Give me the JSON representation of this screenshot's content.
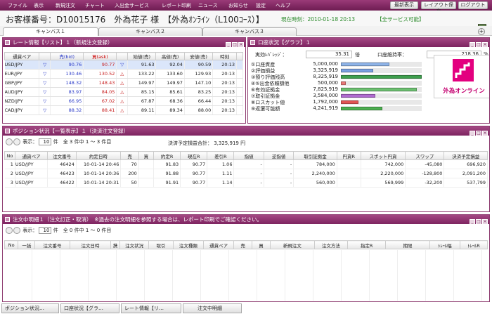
{
  "menu": {
    "items": [
      "ファイル",
      "表示",
      "新規注文",
      "チャート",
      "入出金サービス",
      "レポート印刷",
      "ニュース",
      "お知らせ",
      "設定",
      "ヘルプ"
    ]
  },
  "top_buttons": {
    "latest": "最新表示",
    "save_layout": "レイアウト保存",
    "logout": "ログアウト"
  },
  "customer": {
    "label": "お客様番号：D10015176　外為花子 様　【外為ｵﾝﾗｲﾝ（L100ｺｰｽ）】"
  },
  "clock": {
    "text": "現在時刻：2010-01-18 20:13"
  },
  "service": {
    "text": "【全サービス可能】"
  },
  "canvas_tabs": [
    "キャンバス１",
    "キャンバス２",
    "キャンバス３"
  ],
  "rate_panel": {
    "title": "レート情報【リスト】１（新規注文登録）",
    "headers": [
      "通貨ペア",
      "売(bid)",
      "買(ask)",
      "始値(売)",
      "高値(売)",
      "安値(売)",
      "時刻"
    ],
    "rows": [
      {
        "pair": "USD/JPY",
        "bid": "90.76",
        "ask": "90.77",
        "open": "91.63",
        "high": "92.04",
        "low": "90.59",
        "time": "20:13"
      },
      {
        "pair": "EUR/JPY",
        "bid": "130.46",
        "ask": "130.52",
        "open": "133.22",
        "high": "133.60",
        "low": "129.93",
        "time": "20:13"
      },
      {
        "pair": "GBP/JPY",
        "bid": "148.32",
        "ask": "148.43",
        "open": "149.97",
        "high": "149.97",
        "low": "147.10",
        "time": "20:13"
      },
      {
        "pair": "AUD/JPY",
        "bid": "83.97",
        "ask": "84.05",
        "open": "85.15",
        "high": "85.61",
        "low": "83.25",
        "time": "20:13"
      },
      {
        "pair": "NZD/JPY",
        "bid": "66.95",
        "ask": "67.02",
        "open": "67.87",
        "high": "68.36",
        "low": "66.44",
        "time": "20:13"
      },
      {
        "pair": "CAD/JPY",
        "bid": "88.32",
        "ask": "88.41",
        "open": "89.11",
        "high": "89.34",
        "low": "88.00",
        "time": "20:13"
      }
    ]
  },
  "account_panel": {
    "title": "口座状況【グラフ】１",
    "leverage_label": "実効ﾚﾊﾞﾚｯｼﾞ：",
    "leverage_value": "35.31",
    "leverage_unit": "倍",
    "margin_label": "口座維持率：",
    "margin_value": "218.36",
    "margin_unit": "%",
    "items": [
      {
        "label": "①口座資産",
        "value": "5,000,000",
        "ratio": 0.6,
        "color": "#8fb4e8"
      },
      {
        "label": "②評価損益",
        "value": "3,325,919",
        "ratio": 0.4,
        "color": "#7aa0e0"
      },
      {
        "label": "③預り評価残高",
        "value": "8,325,919",
        "ratio": 1.0,
        "color": "#3ea04e"
      },
      {
        "label": "④⑤出金依頼額他",
        "value": "500,000",
        "ratio": 0.06,
        "color": "#e87878"
      },
      {
        "label": "⑥有効証拠金",
        "value": "7,825,919",
        "ratio": 0.94,
        "color": "#6cc070"
      },
      {
        "label": "⑦取引証拠金",
        "value": "3,584,000",
        "ratio": 0.43,
        "color": "#b06ad0"
      },
      {
        "label": "⑧ロスカット値",
        "value": "1,792,000",
        "ratio": 0.22,
        "color": "#e05454"
      },
      {
        "label": "⑨返還可能額",
        "value": "4,241,919",
        "ratio": 0.51,
        "color": "#4caf50"
      }
    ],
    "logo_text": "外為オンライン"
  },
  "position_panel": {
    "title": "ポジション状況【一覧表示】１（決済注文登録）",
    "display_label": "表示：",
    "display_count": "10",
    "count_text": "件　全 3 件中 1 ～ 3 件目",
    "pl_text": "決済予定損益合計： 3,325,919 円",
    "headers": [
      "No",
      "通貨ペア",
      "注文番号",
      "約定日時",
      "売",
      "買",
      "約定R",
      "現在R",
      "差引R",
      "指値",
      "逆指値",
      "取引証拠金",
      "円貨R",
      "スポット円貨",
      "スワップ",
      "決済予定損益"
    ],
    "rows": [
      {
        "no": "1",
        "pair": "USD/JPY",
        "order": "46424",
        "date": "10-01-14 20:46",
        "sell": "70",
        "buy": "",
        "exec": "91.83",
        "curr": "90.77",
        "diff": "1.06",
        "limit": "-",
        "stop": "-",
        "margin": "784,000",
        "jpy": "",
        "spot": "742,000",
        "swap": "-45,080",
        "pl": "696,920"
      },
      {
        "no": "2",
        "pair": "USD/JPY",
        "order": "46423",
        "date": "10-01-14 20:36",
        "sell": "200",
        "buy": "",
        "exec": "91.88",
        "curr": "90.77",
        "diff": "1.11",
        "limit": "-",
        "stop": "-",
        "margin": "2,240,000",
        "jpy": "",
        "spot": "2,220,000",
        "swap": "-128,800",
        "pl": "2,091,200"
      },
      {
        "no": "3",
        "pair": "USD/JPY",
        "order": "46422",
        "date": "10-01-14 20:31",
        "sell": "50",
        "buy": "",
        "exec": "91.91",
        "curr": "90.77",
        "diff": "1.14",
        "limit": "-",
        "stop": "-",
        "margin": "560,000",
        "jpy": "",
        "spot": "569,999",
        "swap": "-32,200",
        "pl": "537,799"
      }
    ]
  },
  "order_panel": {
    "title": "注文中明細１（注文訂正・取消）　※過去の注文明細を参照する場合は、レポート印刷でご確認ください。",
    "display_label": "表示：",
    "display_count": "10",
    "count_text": "件　全 0 件中 1 ～ 0 件目",
    "headers": [
      "No",
      "一括",
      "注文番号",
      "注文日時",
      "携",
      "注文状況",
      "取引",
      "注文種類",
      "通貨ペア",
      "売",
      "買",
      "新規注文",
      "注文方法",
      "指定R",
      "期限",
      "ﾄﾚｰﾙ幅",
      "ﾄﾚｰﾙR"
    ]
  },
  "bottom_tabs": [
    "ポジション状況…",
    "口座状況【グラ…",
    "レート情報【リ…",
    "注文中明細"
  ]
}
